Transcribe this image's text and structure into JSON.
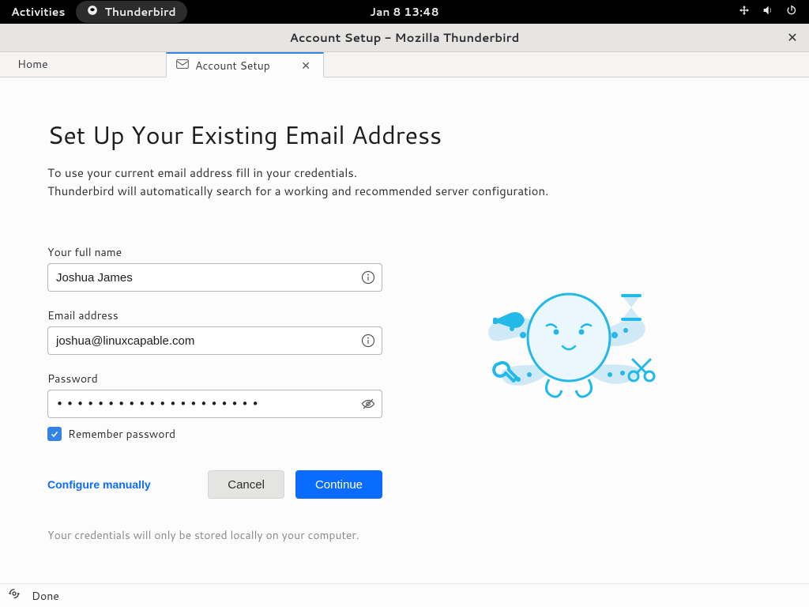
{
  "topbar": {
    "activities": "Activities",
    "app_name": "Thunderbird",
    "datetime": "Jan 8  13:48"
  },
  "window": {
    "title": "Account Setup - Mozilla Thunderbird"
  },
  "tabs": {
    "home": "Home",
    "account_setup": "Account Setup"
  },
  "page": {
    "heading": "Set Up Your Existing Email Address",
    "subtitle_line1": "To use your current email address fill in your credentials.",
    "subtitle_line2": "Thunderbird will automatically search for a working and recommended server configuration."
  },
  "form": {
    "name_label": "Your full name",
    "name_value": "Joshua James",
    "email_label": "Email address",
    "email_value": "joshua@linuxcapable.com",
    "password_label": "Password",
    "password_mask": "••••••••••••••••••••",
    "remember_label": "Remember password",
    "remember_checked": true,
    "configure_manually": "Configure manually",
    "cancel": "Cancel",
    "continue": "Continue",
    "note": "Your credentials will only be stored locally on your computer."
  },
  "statusbar": {
    "done": "Done"
  }
}
